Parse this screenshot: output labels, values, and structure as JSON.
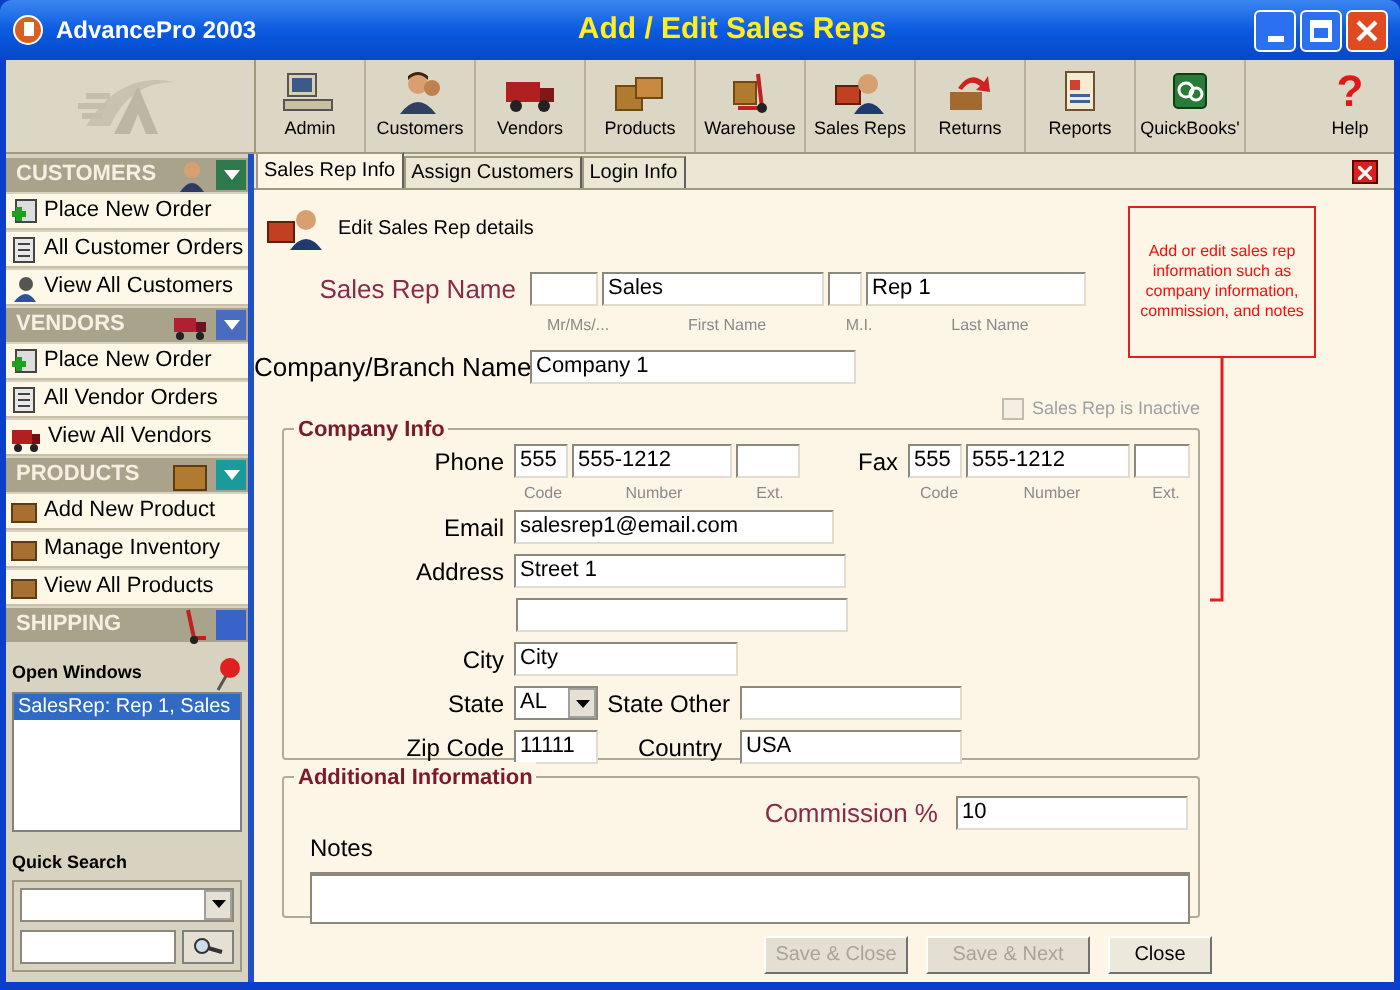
{
  "window": {
    "app_name": "AdvancePro 2003",
    "title": "Add / Edit Sales Reps"
  },
  "toolbar": [
    {
      "label": "Admin"
    },
    {
      "label": "Customers"
    },
    {
      "label": "Vendors"
    },
    {
      "label": "Products"
    },
    {
      "label": "Warehouse"
    },
    {
      "label": "Sales Reps"
    },
    {
      "label": "Returns"
    },
    {
      "label": "Reports"
    },
    {
      "label": "QuickBooks'"
    },
    {
      "label": "Help",
      "glyph": "?"
    }
  ],
  "sidebar": {
    "sections": [
      {
        "title": "CUSTOMERS",
        "color": "#2f7a4c",
        "expanded": true,
        "items": [
          "Place New Order",
          "All Customer Orders",
          "View All Customers"
        ]
      },
      {
        "title": "VENDORS",
        "color": "#4a6cc0",
        "expanded": true,
        "items": [
          "Place New Order",
          "All Vendor Orders",
          "View All Vendors"
        ]
      },
      {
        "title": "PRODUCTS",
        "color": "#1a9a9a",
        "expanded": true,
        "items": [
          "Add New Product",
          "Manage Inventory",
          "View All Products"
        ]
      },
      {
        "title": "SHIPPING",
        "color": "#3a63c8",
        "expanded": false
      }
    ],
    "open_windows": {
      "title": "Open Windows",
      "items": [
        {
          "label": "SalesRep: Rep 1, Sales",
          "selected": true
        }
      ]
    },
    "quick_search": {
      "title": "Quick Search"
    }
  },
  "tabs": [
    {
      "label": "Sales Rep Info",
      "selected": true
    },
    {
      "label": "Assign Customers",
      "selected": false
    },
    {
      "label": "Login Info",
      "selected": false
    }
  ],
  "header": "Edit Sales Rep details",
  "callout": "Add or edit sales rep information such as company information, commission, and notes",
  "form": {
    "sales_rep_name": {
      "label": "Sales Rep Name",
      "required": true,
      "fields": [
        {
          "sublabel": "Mr/Ms/..."
        },
        {
          "value": "Sales",
          "sublabel": "First Name"
        },
        {
          "sublabel": "M.I."
        },
        {
          "value": "Rep 1",
          "sublabel": "Last Name"
        }
      ]
    },
    "company_branch": {
      "label": "Company/Branch Name",
      "required": false,
      "value": "Company 1"
    },
    "inactive": {
      "label": "Sales Rep is Inactive",
      "checked": false,
      "disabled": true
    },
    "company_info": {
      "title": "Company Info",
      "phone": {
        "label": "Phone",
        "parts": [
          {
            "value": "555",
            "sublabel": "Code"
          },
          {
            "value": "555-1212",
            "sublabel": "Number"
          },
          {
            "sublabel": "Ext."
          }
        ]
      },
      "fax": {
        "label": "Fax",
        "parts": [
          {
            "value": "555",
            "sublabel": "Code"
          },
          {
            "value": "555-1212",
            "sublabel": "Number"
          },
          {
            "sublabel": "Ext."
          }
        ]
      },
      "email": {
        "label": "Email",
        "value": "salesrep1@email.com"
      },
      "address": {
        "label": "Address",
        "line1": "Street 1"
      },
      "city": {
        "label": "City",
        "value": "City"
      },
      "state": {
        "label": "State",
        "value": "AL"
      },
      "state_other": {
        "label": "State Other"
      },
      "zip": {
        "label": "Zip Code",
        "value": "11111"
      },
      "country": {
        "label": "Country",
        "value": "USA"
      }
    },
    "additional": {
      "title": "Additional Information",
      "commission": {
        "label": "Commission %",
        "required": true,
        "value": "10"
      },
      "notes": {
        "label": "Notes"
      }
    }
  },
  "buttons": [
    {
      "label": "Save & Close",
      "disabled": true
    },
    {
      "label": "Save & Next",
      "disabled": true
    },
    {
      "label": "Close",
      "disabled": false
    }
  ]
}
